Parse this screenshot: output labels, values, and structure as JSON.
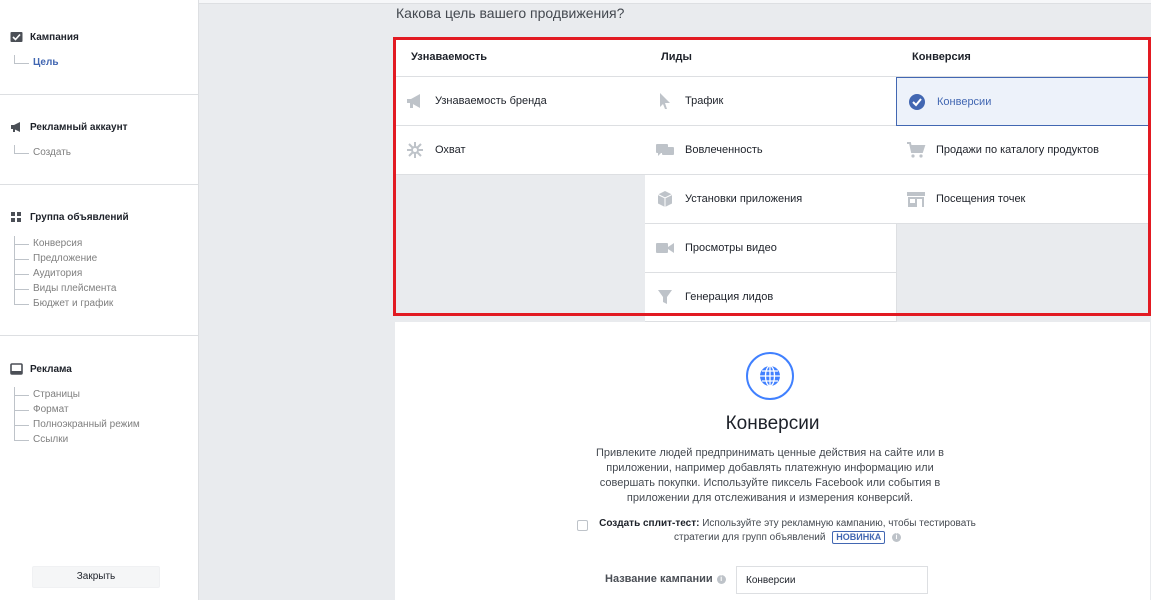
{
  "sidebar": {
    "campaign": {
      "title": "Кампания",
      "items": [
        "Цель"
      ]
    },
    "ad_account": {
      "title": "Рекламный аккаунт",
      "items": [
        "Создать"
      ]
    },
    "ad_set": {
      "title": "Группа объявлений",
      "items": [
        "Конверсия",
        "Предложение",
        "Аудитория",
        "Виды плейсмента",
        "Бюджет и график"
      ]
    },
    "ad": {
      "title": "Реклама",
      "items": [
        "Страницы",
        "Формат",
        "Полноэкранный режим",
        "Ссылки"
      ]
    },
    "close_label": "Закрыть"
  },
  "main": {
    "question": "Какова цель вашего продвижения?",
    "columns": [
      {
        "header": "Узнаваемость",
        "options": [
          "Узнаваемость бренда",
          "Охват"
        ]
      },
      {
        "header": "Лиды",
        "options": [
          "Трафик",
          "Вовлеченность",
          "Установки приложения",
          "Просмотры видео",
          "Генерация лидов"
        ]
      },
      {
        "header": "Конверсия",
        "options": [
          "Конверсии",
          "Продажи по каталогу продуктов",
          "Посещения точек"
        ]
      }
    ],
    "selected": "Конверсии",
    "detail": {
      "title": "Конверсии",
      "description": "Привлеките людей предпринимать ценные действия на сайте или в приложении, например добавлять платежную информацию или совершать покупки. Используйте пиксель Facebook или события в приложении для отслеживания и измерения конверсий.",
      "split_label": "Создать сплит-тест:",
      "split_text": "Используйте эту рекламную кампанию, чтобы тестировать стратегии для групп объявлений",
      "new_badge": "НОВИНКА",
      "campaign_name_label": "Название кампании",
      "campaign_name_value": "Конверсии"
    }
  },
  "colors": {
    "accent": "#4267b2",
    "highlight_frame": "#e21a22",
    "icon_gray": "#bec3c9"
  }
}
